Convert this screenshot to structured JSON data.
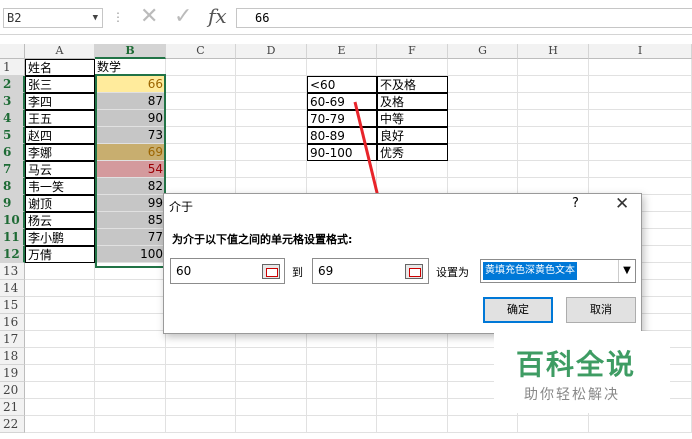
{
  "formula_bar": {
    "name_box": "B2",
    "value": "66",
    "fx": "fx",
    "cancel_icon": "✕",
    "enter_icon": "✓"
  },
  "columns": [
    "A",
    "B",
    "C",
    "D",
    "E",
    "F",
    "G",
    "H",
    "I"
  ],
  "rows": [
    "1",
    "2",
    "3",
    "4",
    "5",
    "6",
    "7",
    "8",
    "9",
    "10",
    "11",
    "12",
    "13",
    "14",
    "15",
    "16",
    "17",
    "18",
    "19",
    "20",
    "21",
    "22"
  ],
  "col_a": [
    "姓名",
    "张三",
    "李四",
    "王五",
    "赵四",
    "李娜",
    "马云",
    "韦一笑",
    "谢顶",
    "杨云",
    "李小鹏",
    "万倩"
  ],
  "col_b": [
    "数学",
    "66",
    "87",
    "90",
    "73",
    "69",
    "54",
    "82",
    "99",
    "85",
    "77",
    "100"
  ],
  "grade_table": [
    [
      "<60",
      "不及格"
    ],
    [
      "60-69",
      "及格"
    ],
    [
      "70-79",
      "中等"
    ],
    [
      "80-89",
      "良好"
    ],
    [
      "90-100",
      "优秀"
    ]
  ],
  "colors": {
    "yellow_fill": "#ffeb9c",
    "gray_fill": "#c6c6c6",
    "dark_yellow_fill": "#c8ae6f",
    "red_fill": "#d49a9d",
    "accent": "#217346",
    "arrow": "#e8242a"
  },
  "dialog": {
    "title": "介于",
    "help": "?",
    "close": "✕",
    "prompt": "为介于以下值之间的单元格设置格式:",
    "min_value": "60",
    "to_label": "到",
    "max_value": "69",
    "set_as_label": "设置为",
    "format_option": "黄填充色深黄色文本",
    "ok": "确定",
    "cancel": "取消"
  },
  "watermark": {
    "main": "百科全说",
    "sub": "助你轻松解决"
  }
}
